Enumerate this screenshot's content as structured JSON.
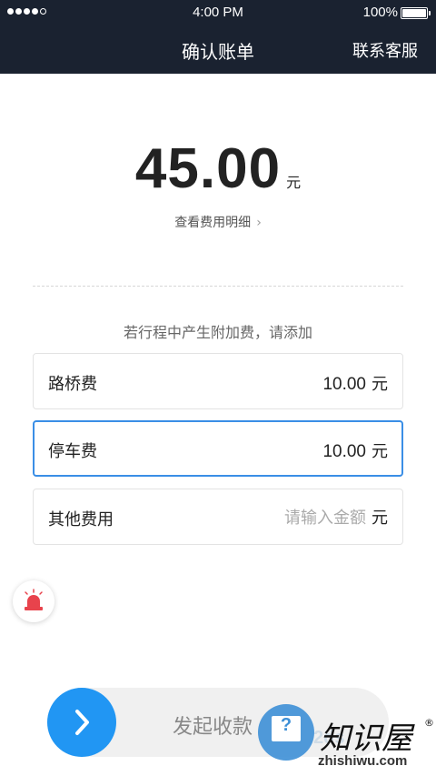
{
  "status_bar": {
    "time": "4:00 PM",
    "battery": "100%",
    "signal_bars_filled": 4,
    "signal_bars_total": 5
  },
  "nav": {
    "title": "确认账单",
    "action": "联系客服"
  },
  "bill": {
    "amount": "45.00",
    "unit": "元",
    "detail_link": "查看费用明细",
    "detail_chevron": "›"
  },
  "extra_fees": {
    "hint": "若行程中产生附加费，请添加",
    "rows": [
      {
        "label": "路桥费",
        "value": "10.00",
        "unit": "元",
        "active": false
      },
      {
        "label": "停车费",
        "value": "10.00",
        "unit": "元",
        "active": true
      },
      {
        "label": "其他费用",
        "value": "",
        "placeholder": "请输入金额",
        "unit": "元",
        "active": false
      }
    ]
  },
  "alarm": {
    "icon": "alarm-siren-icon",
    "color": "#e8434c"
  },
  "submit": {
    "label": "发起收款",
    "icon": "chevron-right-icon",
    "accent": "#2196f3"
  },
  "watermark": {
    "icon": "question-monitor-icon",
    "brand": "知识屋",
    "reg_mark": "®",
    "url": "zhishiwu.com"
  },
  "colors": {
    "header_bg": "#1a2230",
    "active_border": "#3a8ee6"
  }
}
